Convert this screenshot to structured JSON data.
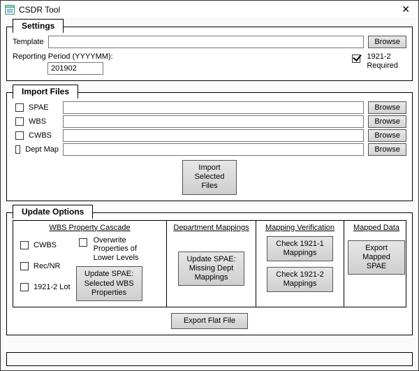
{
  "window": {
    "title": "CSDR Tool",
    "close_glyph": "✕"
  },
  "settings": {
    "title": "Settings",
    "template_label": "Template",
    "template_value": "",
    "template_browse": "Browse",
    "period_label": "Reporting Period (YYYYMM):",
    "period_value": "201902",
    "req_checked": true,
    "req_line1": "1921-2",
    "req_line2": "Required"
  },
  "import": {
    "title": "Import Files",
    "browse": "Browse",
    "import_btn_l1": "Import",
    "import_btn_l2": "Selected",
    "import_btn_l3": "Files",
    "rows": {
      "spae": {
        "label": "SPAE",
        "checked": false,
        "value": ""
      },
      "wbs": {
        "label": "WBS",
        "checked": false,
        "value": ""
      },
      "cwbs": {
        "label": "CWBS",
        "checked": false,
        "value": ""
      },
      "dept": {
        "label": "Dept Map",
        "checked": false,
        "value": ""
      }
    }
  },
  "update": {
    "title": "Update Options",
    "wbs": {
      "title": "WBS Property Cascade",
      "cwbs_label": "CWBS",
      "rec_label": "Rec/NR",
      "lot_label": "1921-2 Lot",
      "overwrite_label": "Overwrite Properties of Lower Levels",
      "btn_l1": "Update SPAE:",
      "btn_l2": "Selected WBS",
      "btn_l3": "Properties"
    },
    "dept": {
      "title": "Department Mappings",
      "btn_l1": "Update SPAE:",
      "btn_l2": "Missing Dept",
      "btn_l3": "Mappings"
    },
    "verify": {
      "title": "Mapping Verification",
      "btn1_l1": "Check 1921-1",
      "btn1_l2": "Mappings",
      "btn2_l1": "Check 1921-2",
      "btn2_l2": "Mappings"
    },
    "mapped": {
      "title": "Mapped Data",
      "btn_l1": "Export Mapped",
      "btn_l2": "SPAE"
    },
    "export_flat": "Export Flat File"
  }
}
